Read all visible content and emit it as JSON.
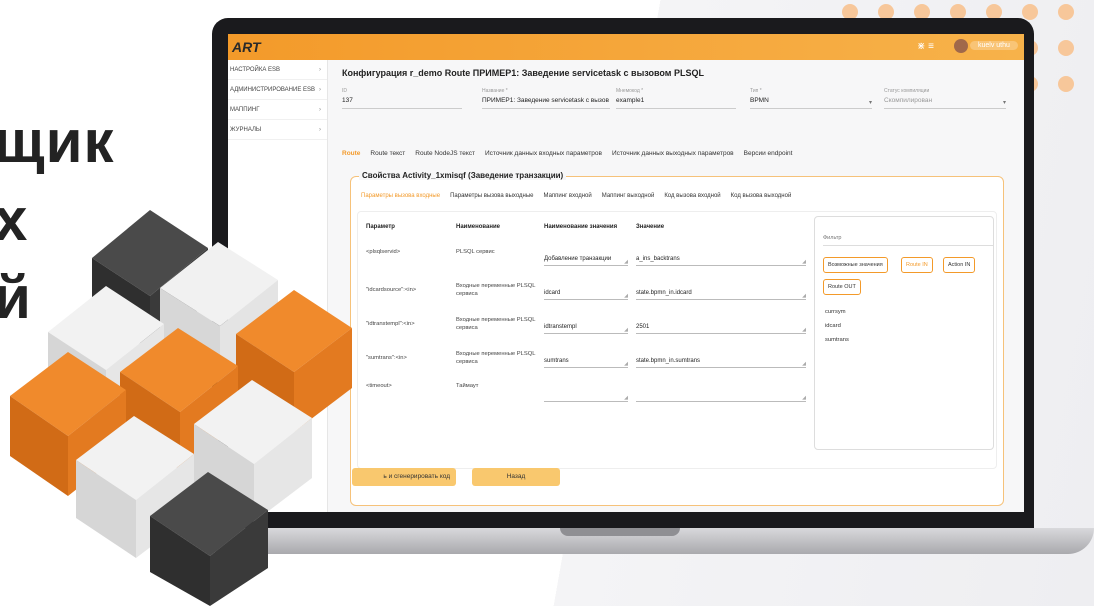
{
  "colors": {
    "accent": "#f39a2a",
    "dots": "#f7c79a",
    "dark": "#232323"
  },
  "headline": {
    "line1": "щик",
    "line2": "х",
    "line3": "й"
  },
  "app": {
    "logo": "ART",
    "topbar_icons": "⋇ ≡",
    "user": "kuelv      uthu"
  },
  "sidebar": {
    "items": [
      {
        "label": "НАСТРОЙКА ESB"
      },
      {
        "label": "АДМИНИСТРИРОВАНИЕ ESB"
      },
      {
        "label": "МАППИНГ"
      },
      {
        "label": "ЖУРНАЛЫ"
      }
    ]
  },
  "page": {
    "title": "Конфигурация r_demo Route ПРИМЕР1: Заведение servicetask с вызовом PLSQL",
    "fields": {
      "id_label": "ID",
      "id_value": "137",
      "name_label": "Название *",
      "name_value": "ПРИМЕР1: Заведение servicetask с вызов",
      "mnemonic_label": "Мнемокод *",
      "mnemonic_value": "example1",
      "type_label": "Тип *",
      "type_value": "BPMN",
      "status_label": "Статус компиляции",
      "status_value": "Скомпилирован"
    },
    "tabs": [
      "Route",
      "Route текст",
      "Route NodeJS текст",
      "Источник данных входных параметров",
      "Источник данных выходных параметров",
      "Версии endpoint"
    ],
    "panel_title": "Свойства Activity_1xmisqf (Заведение транзакции)",
    "subtabs": [
      "Параметры вызова входные",
      "Параметры вызова выходные",
      "Маппинг входной",
      "Маппинг выходной",
      "Код вызова входной",
      "Код вызова выходной"
    ],
    "table": {
      "headers": [
        "Параметр",
        "Наименование",
        "Наименование значения",
        "Значение"
      ],
      "rows": [
        {
          "param": "<plsqlservid>",
          "name": "PLSQL сервис",
          "value_name": "Добавление транзакции",
          "value": "a_ins_backtrans"
        },
        {
          "param": "\"idcardsource\":<in>",
          "name": "Входные переменные PLSQL сервиса",
          "value_name": "idcard",
          "value": "state.bpmn_in.idcard"
        },
        {
          "param": "\"idtranstempl\":<in>",
          "name": "Входные переменные PLSQL сервиса",
          "value_name": "idtranstempl",
          "value": "2501"
        },
        {
          "param": "\"sumtrans\":<in>",
          "name": "Входные переменные PLSQL сервиса",
          "value_name": "sumtrans",
          "value": "state.bpmn_in.sumtrans"
        },
        {
          "param": "<timeout>",
          "name": "Таймаут",
          "value_name": "",
          "value": ""
        }
      ]
    },
    "filter": {
      "label": "Фильтр",
      "buttons": [
        "Возможные значения",
        "Route IN",
        "Action IN",
        "Route OUT"
      ],
      "list": [
        "currsym",
        "idcard",
        "sumtrans"
      ]
    },
    "save_button": "ь и сгенерировать код",
    "back_button": "Назад"
  }
}
